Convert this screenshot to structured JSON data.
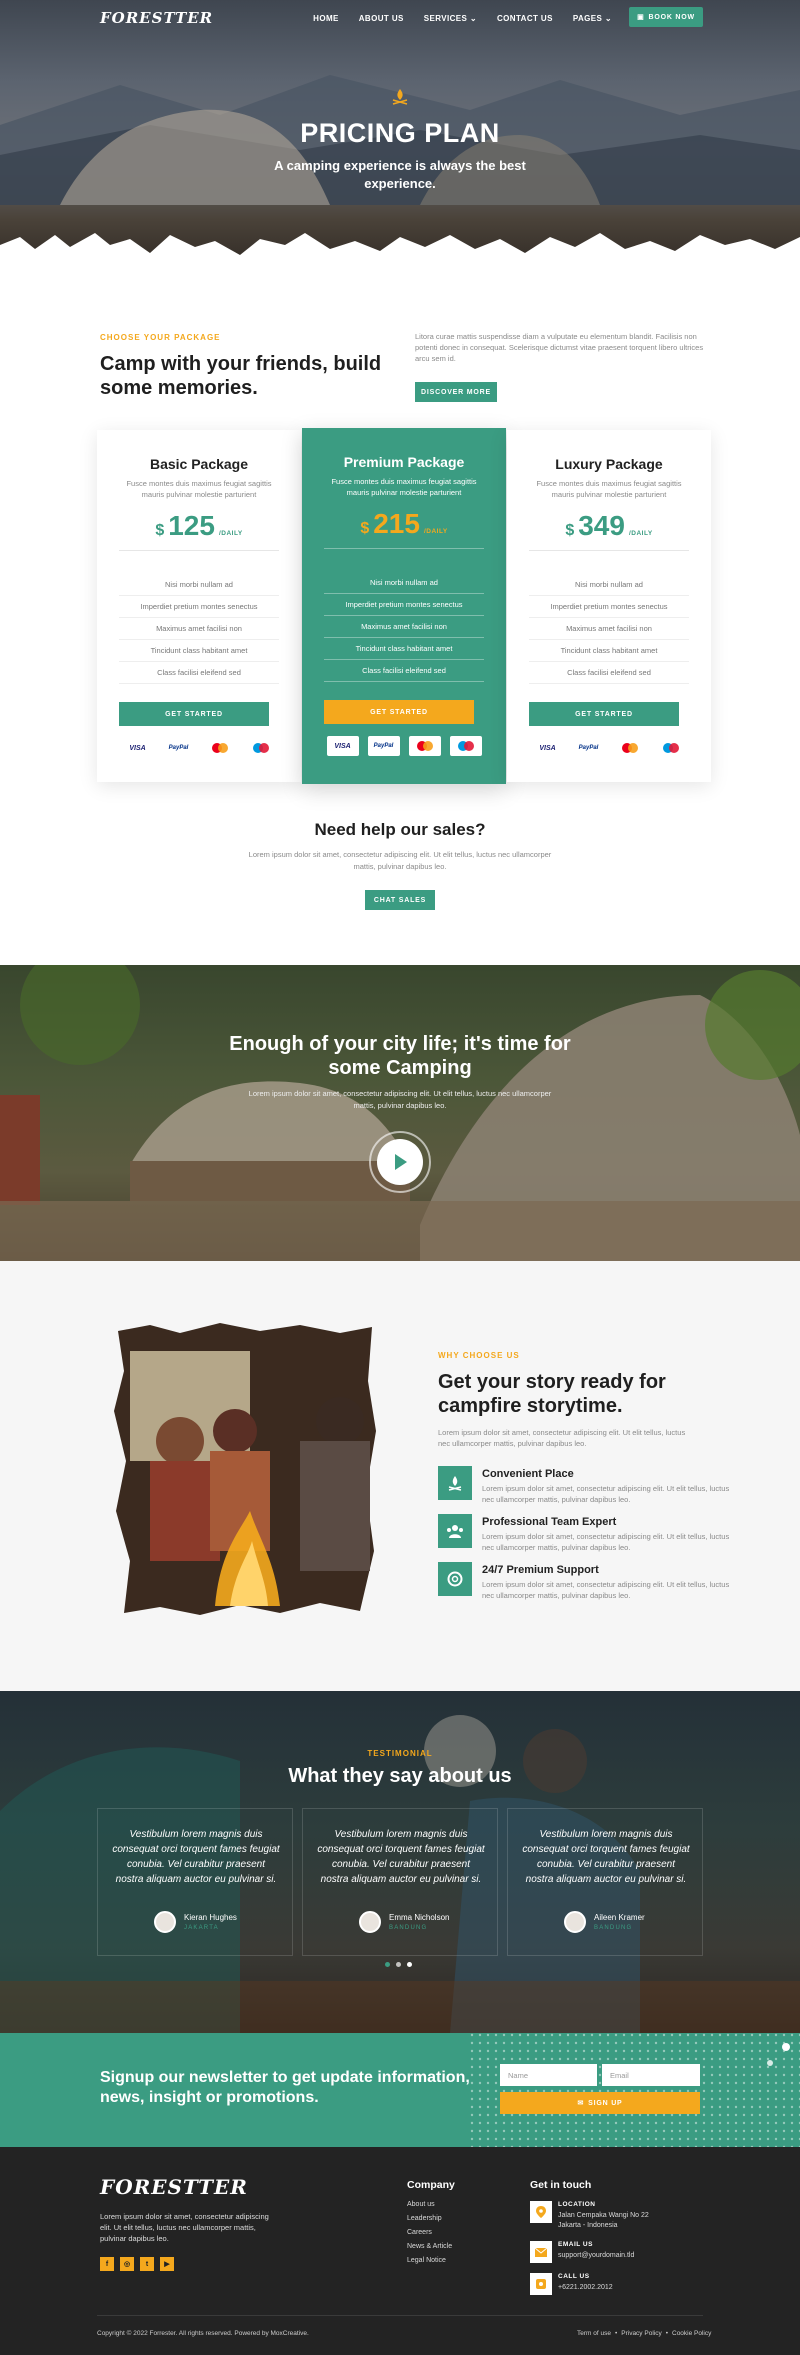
{
  "brand": {
    "logo": "FORESTTER",
    "accent": "#3b9c82",
    "highlight": "#f4a81d",
    "dark": "#232323"
  },
  "nav": {
    "items": [
      "HOME",
      "ABOUT US",
      "SERVICES",
      "CONTACT US",
      "PAGES"
    ],
    "book_label": "BOOK NOW"
  },
  "hero": {
    "title": "PRICING PLAN",
    "subtitle_line1": "A camping experience is always the best",
    "subtitle_line2": "experience."
  },
  "intro": {
    "tag": "CHOOSE YOUR PACKAGE",
    "title_line1": "Camp with your friends, build",
    "title_line2": "some memories.",
    "text": "Litora curae mattis suspendisse diam a vulputate eu elementum blandit. Facilisis non potenti donec in consequat. Scelerisque dictumst vitae praesent torquent libero ultrices arcu sem id.",
    "button": "DISCOVER MORE"
  },
  "pricing": {
    "currency": "$",
    "period": "/DAILY",
    "button": "GET STARTED",
    "payments": [
      "VISA",
      "PayPal",
      "mastercard",
      "maestro"
    ],
    "plans": [
      {
        "name": "Basic Package",
        "desc": "Fusce montes duis maximus feugiat sagittis mauris pulvinar molestie parturient",
        "price": "125",
        "features": [
          "Nisi morbi nullam ad",
          "Imperdiet pretium montes senectus",
          "Maximus amet facilisi non",
          "Tincidunt class habitant amet",
          "Class facilisi eleifend sed"
        ]
      },
      {
        "name": "Premium Package",
        "desc": "Fusce montes duis maximus feugiat sagittis mauris pulvinar molestie parturient",
        "price": "215",
        "features": [
          "Nisi morbi nullam ad",
          "Imperdiet pretium montes senectus",
          "Maximus amet facilisi non",
          "Tincidunt class habitant amet",
          "Class facilisi eleifend sed"
        ]
      },
      {
        "name": "Luxury Package",
        "desc": "Fusce montes duis maximus feugiat sagittis mauris pulvinar molestie parturient",
        "price": "349",
        "features": [
          "Nisi morbi nullam ad",
          "Imperdiet pretium montes senectus",
          "Maximus amet facilisi non",
          "Tincidunt class habitant amet",
          "Class facilisi eleifend sed"
        ]
      }
    ]
  },
  "sales": {
    "title": "Need help our sales?",
    "text_line1": "Lorem ipsum dolor sit amet, consectetur adipiscing elit. Ut elit tellus, luctus nec ullamcorper",
    "text_line2": "mattis, pulvinar dapibus leo.",
    "button": "CHAT SALES"
  },
  "video": {
    "title_line1": "Enough of your city life; it's time for",
    "title_line2": "some Camping",
    "text_line1": "Lorem ipsum dolor sit amet, consectetur adipiscing elit. Ut elit tellus, luctus nec ullamcorper",
    "text_line2": "mattis, pulvinar dapibus leo."
  },
  "why": {
    "tag": "WHY CHOOSE US",
    "title_line1": "Get your story ready for",
    "title_line2": "campfire storytime.",
    "text": "Lorem ipsum dolor sit amet, consectetur adipiscing elit. Ut elit tellus, luctus nec ullamcorper mattis, pulvinar dapibus leo.",
    "features": [
      {
        "icon": "campfire-icon",
        "title": "Convenient Place",
        "text": "Lorem ipsum dolor sit amet, consectetur adipiscing elit. Ut elit tellus, luctus nec ullamcorper mattis, pulvinar dapibus leo."
      },
      {
        "icon": "team-icon",
        "title": "Professional Team Expert",
        "text": "Lorem ipsum dolor sit amet, consectetur adipiscing elit. Ut elit tellus, luctus nec ullamcorper mattis, pulvinar dapibus leo."
      },
      {
        "icon": "support-icon",
        "title": "24/7 Premium Support",
        "text": "Lorem ipsum dolor sit amet, consectetur adipiscing elit. Ut elit tellus, luctus nec ullamcorper mattis, pulvinar dapibus leo."
      }
    ]
  },
  "testimonials": {
    "tag": "TESTIMONIAL",
    "title": "What they say about us",
    "items": [
      {
        "quote": "Vestibulum lorem magnis duis consequat orci torquent fames feugiat conubia. Vel curabitur praesent nostra aliquam auctor eu pulvinar si.",
        "name": "Kieran Hughes",
        "city": "JAKARTA"
      },
      {
        "quote": "Vestibulum lorem magnis duis consequat orci torquent fames feugiat conubia. Vel curabitur praesent nostra aliquam auctor eu pulvinar si.",
        "name": "Emma Nicholson",
        "city": "BANDUNG"
      },
      {
        "quote": "Vestibulum lorem magnis duis consequat orci torquent fames feugiat conubia. Vel curabitur praesent nostra aliquam auctor eu pulvinar si.",
        "name": "Aileen Kramer",
        "city": "BANDUNG"
      }
    ]
  },
  "newsletter": {
    "title_line1": "Signup our newsletter to get update information,",
    "title_line2": "news, insight or promotions.",
    "name_placeholder": "Name",
    "email_placeholder": "Email",
    "button": "SIGN UP"
  },
  "footer": {
    "about": "Lorem ipsum dolor sit amet, consectetur adipiscing elit. Ut elit tellus, luctus nec ullamcorper mattis, pulvinar dapibus leo.",
    "company_title": "Company",
    "company_links": [
      "About us",
      "Leadership",
      "Careers",
      "News & Article",
      "Legal Notice"
    ],
    "contact_title": "Get in touch",
    "location_label": "LOCATION",
    "location_line1": "Jalan Cempaka Wangi No 22",
    "location_line2": "Jakarta - Indonesia",
    "email_label": "EMAIL US",
    "email": "support@yourdomain.tld",
    "call_label": "CALL US",
    "phone": "+6221.2002.2012",
    "copyright": "Copyright © 2022 Forrester. All rights reserved. Powered by MoxCreative.",
    "legal_links": [
      "Term of use",
      "Privacy Policy",
      "Cookie Policy"
    ]
  }
}
